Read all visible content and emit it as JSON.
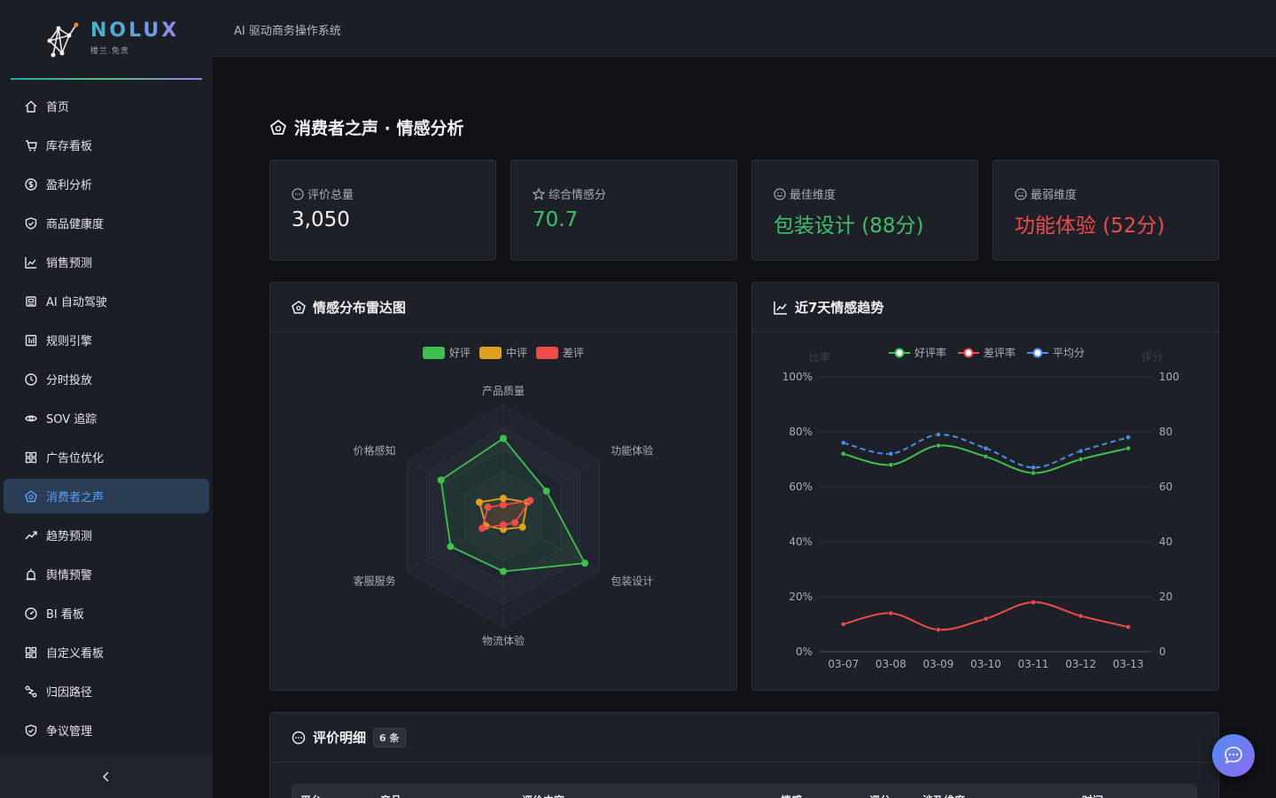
{
  "app": {
    "logo_text": "NOLUX",
    "logo_sub": "楼兰.免责",
    "topbar_title": "AI 驱动商务操作系统"
  },
  "sidebar": {
    "items": [
      {
        "label": "首页",
        "icon": "home-icon"
      },
      {
        "label": "库存看板",
        "icon": "cart-icon"
      },
      {
        "label": "盈利分析",
        "icon": "dollar-icon"
      },
      {
        "label": "商品健康度",
        "icon": "shield-icon"
      },
      {
        "label": "销售预测",
        "icon": "line-chart-icon"
      },
      {
        "label": "AI 自动驾驶",
        "icon": "robot-icon"
      },
      {
        "label": "规则引擎",
        "icon": "rules-icon"
      },
      {
        "label": "分时投放",
        "icon": "clock-icon"
      },
      {
        "label": "SOV 追踪",
        "icon": "eye-icon"
      },
      {
        "label": "广告位优化",
        "icon": "grid-icon"
      },
      {
        "label": "消费者之声",
        "icon": "voice-icon",
        "active": true
      },
      {
        "label": "趋势预测",
        "icon": "trend-icon"
      },
      {
        "label": "舆情预警",
        "icon": "alarm-icon"
      },
      {
        "label": "BI 看板",
        "icon": "dashboard-icon"
      },
      {
        "label": "自定义看板",
        "icon": "custom-board-icon"
      },
      {
        "label": "归因路径",
        "icon": "path-icon"
      },
      {
        "label": "争议管理",
        "icon": "dispute-icon"
      }
    ]
  },
  "page": {
    "title": "消费者之声 · 情感分析"
  },
  "stats": [
    {
      "label": "评价总量",
      "value": "3,050",
      "color": "#f1f2f4",
      "icon": "comment-icon"
    },
    {
      "label": "综合情感分",
      "value": "70.7",
      "color": "#3fbf6a",
      "icon": "star-icon"
    },
    {
      "label": "最佳维度",
      "value": "包装设计 (88分)",
      "color": "#3fbf6a",
      "icon": "smile-icon"
    },
    {
      "label": "最弱维度",
      "value": "功能体验 (52分)",
      "color": "#ef4b4b",
      "icon": "frown-icon"
    }
  ],
  "radar_panel": {
    "title": "情感分布雷达图"
  },
  "trend_panel": {
    "title": "近7天情感趋势"
  },
  "detail_panel": {
    "title": "评价明细",
    "count_badge": "6 条",
    "columns": [
      "平台",
      "产品",
      "评价内容",
      "情感",
      "评分",
      "涉及维度",
      "时间"
    ]
  },
  "colors": {
    "good": "#3fbf4f",
    "neutral": "#e0a020",
    "bad": "#ef4b4b",
    "avg": "#4a90e8",
    "accent": "#5aa0f5"
  },
  "chart_data": [
    {
      "type": "radar",
      "indicators": [
        "产品质量",
        "功能体验",
        "包装设计",
        "物流体验",
        "客服服务",
        "价格感知"
      ],
      "max": 100,
      "series": [
        {
          "name": "好评",
          "values": [
            70,
            45,
            85,
            50,
            55,
            65
          ]
        },
        {
          "name": "中评",
          "values": [
            16,
            25,
            20,
            12,
            18,
            25
          ]
        },
        {
          "name": "差评",
          "values": [
            10,
            28,
            12,
            8,
            22,
            16
          ]
        }
      ]
    },
    {
      "type": "line",
      "categories": [
        "03-07",
        "03-08",
        "03-09",
        "03-10",
        "03-11",
        "03-12",
        "03-13"
      ],
      "ylabel_left": "比率",
      "ylabel_right": "评分",
      "y_left_ticks": [
        "0%",
        "20%",
        "40%",
        "60%",
        "80%",
        "100%"
      ],
      "y_right_ticks": [
        "0",
        "20",
        "40",
        "60",
        "80",
        "100"
      ],
      "ylim": [
        0,
        100
      ],
      "grid": true,
      "legend": "top",
      "series": [
        {
          "name": "好评率",
          "axis": "left",
          "values": [
            72,
            68,
            75,
            71,
            65,
            70,
            74
          ]
        },
        {
          "name": "差评率",
          "axis": "left",
          "values": [
            10,
            14,
            8,
            12,
            18,
            13,
            9
          ]
        },
        {
          "name": "平均分",
          "axis": "right",
          "values": [
            76,
            72,
            79,
            74,
            67,
            73,
            78
          ],
          "dashed": true
        }
      ]
    }
  ]
}
